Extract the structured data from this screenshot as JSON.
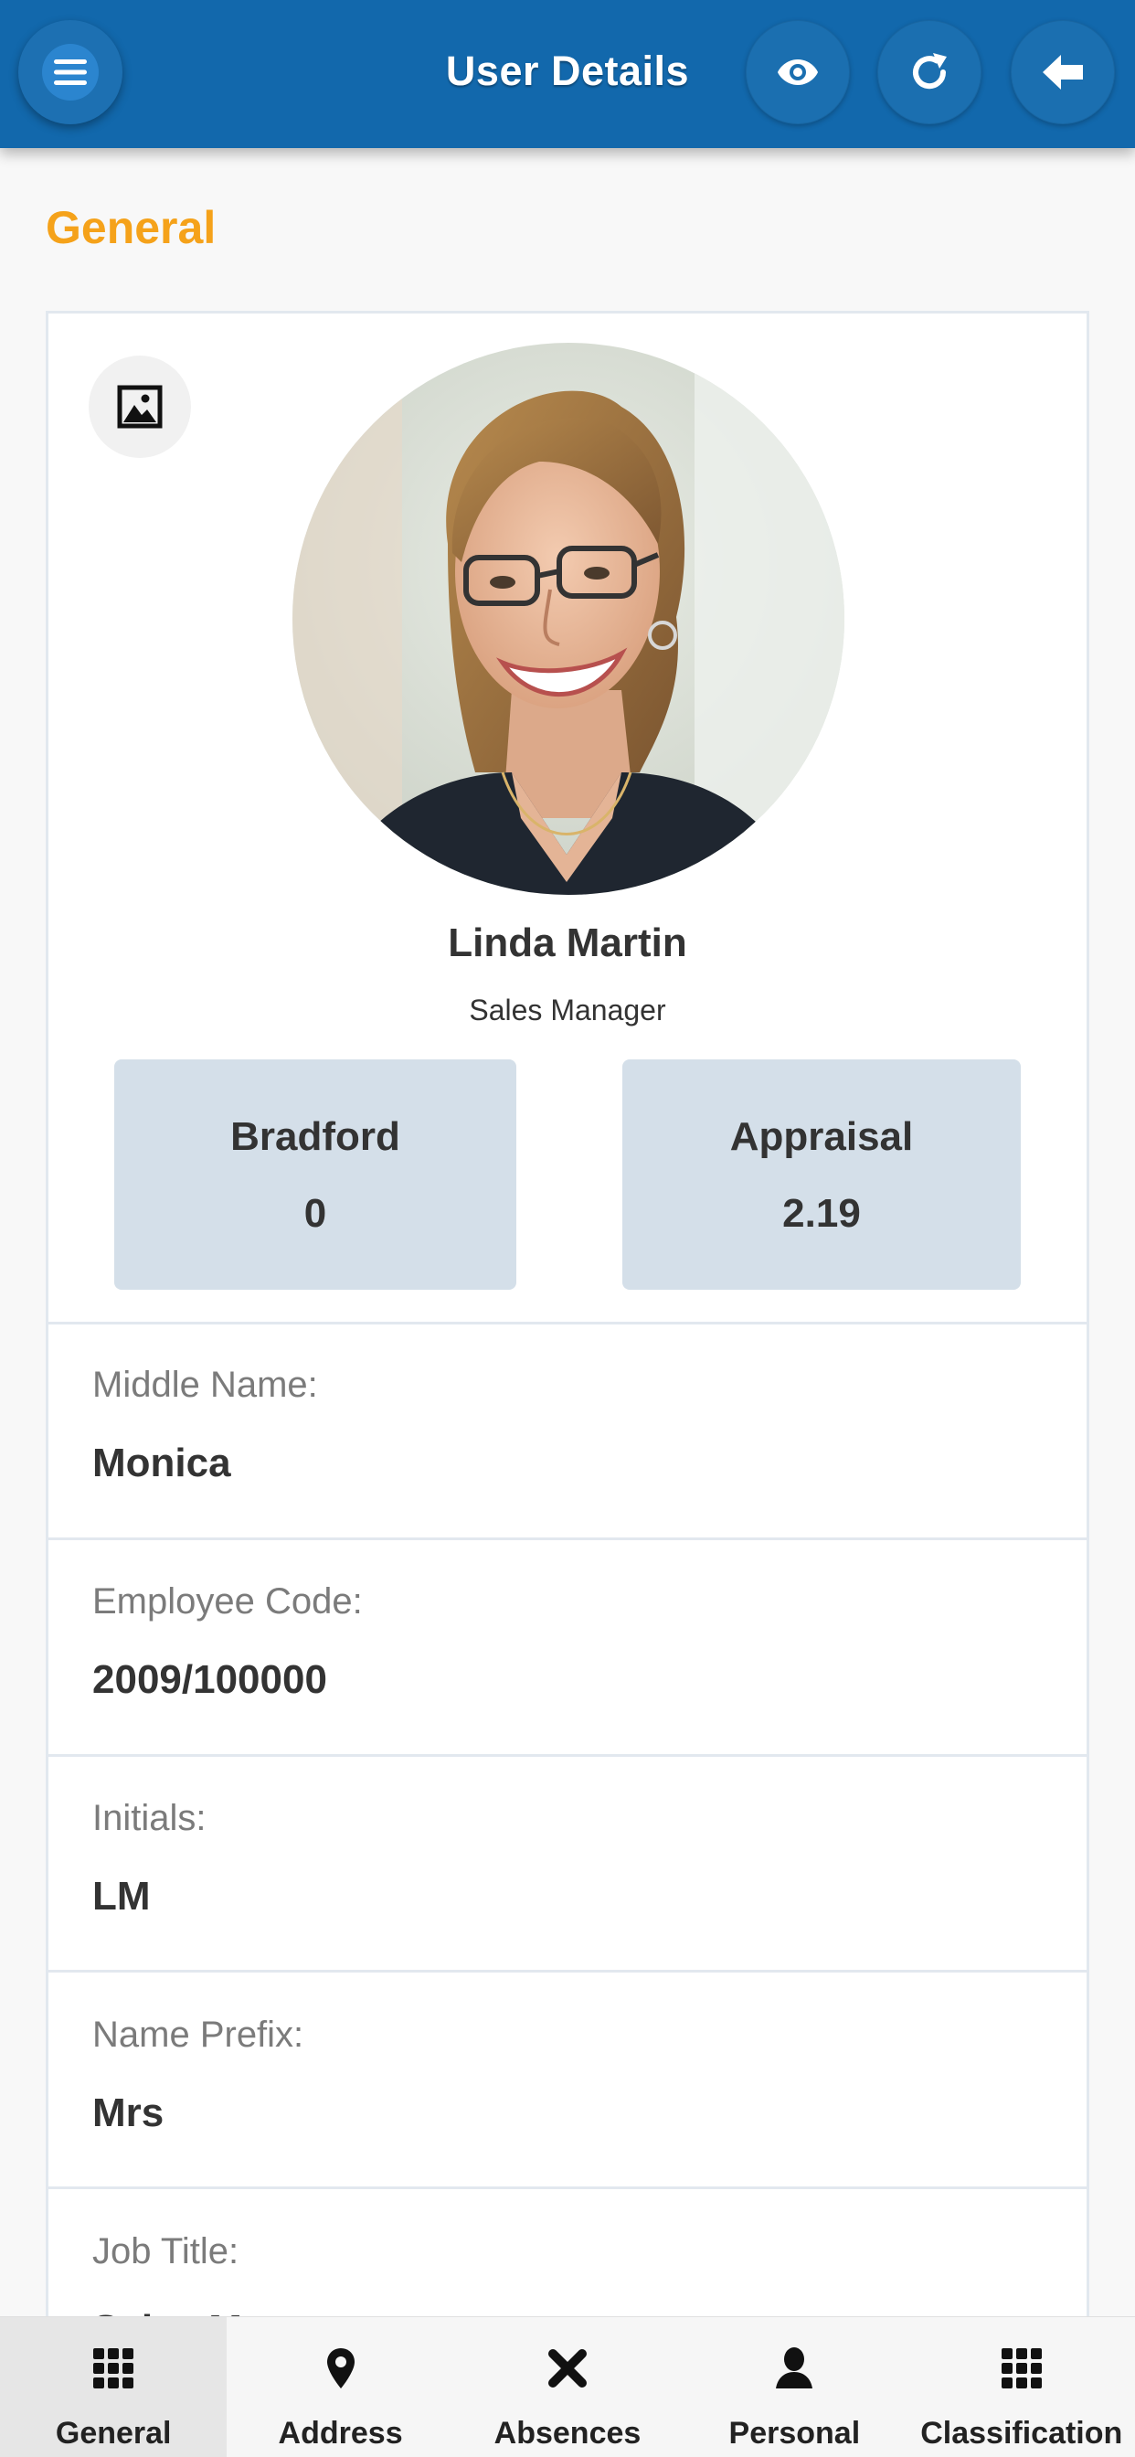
{
  "header": {
    "title": "User Details",
    "color": "#1268ac"
  },
  "section": {
    "title": "General",
    "color": "#f5a21a"
  },
  "profile": {
    "name": "Linda Martin",
    "role": "Sales Manager"
  },
  "stats": [
    {
      "label": "Bradford",
      "value": "0"
    },
    {
      "label": "Appraisal",
      "value": "2.19"
    }
  ],
  "fields": [
    {
      "label": "Middle Name:",
      "value": "Monica"
    },
    {
      "label": "Employee Code:",
      "value": "2009/100000"
    },
    {
      "label": "Initials:",
      "value": "LM"
    },
    {
      "label": "Name Prefix:",
      "value": "Mrs"
    },
    {
      "label": "Job Title:",
      "value": "Sales Manager"
    }
  ],
  "tabs": [
    {
      "label": "General",
      "icon": "grid-icon",
      "active": true
    },
    {
      "label": "Address",
      "icon": "map-pin-icon"
    },
    {
      "label": "Absences",
      "icon": "close-icon"
    },
    {
      "label": "Personal",
      "icon": "person-icon"
    },
    {
      "label": "Classification",
      "icon": "grid-icon"
    }
  ]
}
